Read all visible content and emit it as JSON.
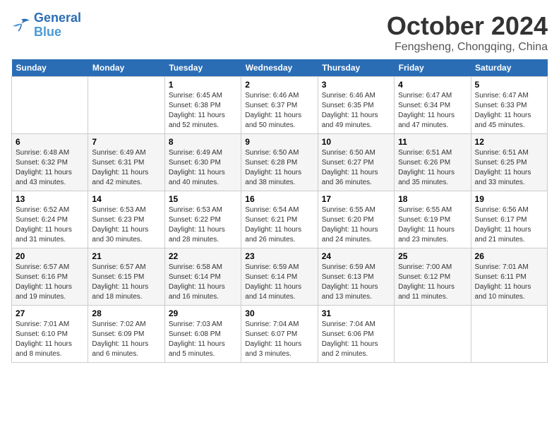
{
  "header": {
    "logo_line1": "General",
    "logo_line2": "Blue",
    "month": "October 2024",
    "location": "Fengsheng, Chongqing, China"
  },
  "weekdays": [
    "Sunday",
    "Monday",
    "Tuesday",
    "Wednesday",
    "Thursday",
    "Friday",
    "Saturday"
  ],
  "weeks": [
    [
      {
        "day": "",
        "info": ""
      },
      {
        "day": "",
        "info": ""
      },
      {
        "day": "1",
        "info": "Sunrise: 6:45 AM\nSunset: 6:38 PM\nDaylight: 11 hours and 52 minutes."
      },
      {
        "day": "2",
        "info": "Sunrise: 6:46 AM\nSunset: 6:37 PM\nDaylight: 11 hours and 50 minutes."
      },
      {
        "day": "3",
        "info": "Sunrise: 6:46 AM\nSunset: 6:35 PM\nDaylight: 11 hours and 49 minutes."
      },
      {
        "day": "4",
        "info": "Sunrise: 6:47 AM\nSunset: 6:34 PM\nDaylight: 11 hours and 47 minutes."
      },
      {
        "day": "5",
        "info": "Sunrise: 6:47 AM\nSunset: 6:33 PM\nDaylight: 11 hours and 45 minutes."
      }
    ],
    [
      {
        "day": "6",
        "info": "Sunrise: 6:48 AM\nSunset: 6:32 PM\nDaylight: 11 hours and 43 minutes."
      },
      {
        "day": "7",
        "info": "Sunrise: 6:49 AM\nSunset: 6:31 PM\nDaylight: 11 hours and 42 minutes."
      },
      {
        "day": "8",
        "info": "Sunrise: 6:49 AM\nSunset: 6:30 PM\nDaylight: 11 hours and 40 minutes."
      },
      {
        "day": "9",
        "info": "Sunrise: 6:50 AM\nSunset: 6:28 PM\nDaylight: 11 hours and 38 minutes."
      },
      {
        "day": "10",
        "info": "Sunrise: 6:50 AM\nSunset: 6:27 PM\nDaylight: 11 hours and 36 minutes."
      },
      {
        "day": "11",
        "info": "Sunrise: 6:51 AM\nSunset: 6:26 PM\nDaylight: 11 hours and 35 minutes."
      },
      {
        "day": "12",
        "info": "Sunrise: 6:51 AM\nSunset: 6:25 PM\nDaylight: 11 hours and 33 minutes."
      }
    ],
    [
      {
        "day": "13",
        "info": "Sunrise: 6:52 AM\nSunset: 6:24 PM\nDaylight: 11 hours and 31 minutes."
      },
      {
        "day": "14",
        "info": "Sunrise: 6:53 AM\nSunset: 6:23 PM\nDaylight: 11 hours and 30 minutes."
      },
      {
        "day": "15",
        "info": "Sunrise: 6:53 AM\nSunset: 6:22 PM\nDaylight: 11 hours and 28 minutes."
      },
      {
        "day": "16",
        "info": "Sunrise: 6:54 AM\nSunset: 6:21 PM\nDaylight: 11 hours and 26 minutes."
      },
      {
        "day": "17",
        "info": "Sunrise: 6:55 AM\nSunset: 6:20 PM\nDaylight: 11 hours and 24 minutes."
      },
      {
        "day": "18",
        "info": "Sunrise: 6:55 AM\nSunset: 6:19 PM\nDaylight: 11 hours and 23 minutes."
      },
      {
        "day": "19",
        "info": "Sunrise: 6:56 AM\nSunset: 6:17 PM\nDaylight: 11 hours and 21 minutes."
      }
    ],
    [
      {
        "day": "20",
        "info": "Sunrise: 6:57 AM\nSunset: 6:16 PM\nDaylight: 11 hours and 19 minutes."
      },
      {
        "day": "21",
        "info": "Sunrise: 6:57 AM\nSunset: 6:15 PM\nDaylight: 11 hours and 18 minutes."
      },
      {
        "day": "22",
        "info": "Sunrise: 6:58 AM\nSunset: 6:14 PM\nDaylight: 11 hours and 16 minutes."
      },
      {
        "day": "23",
        "info": "Sunrise: 6:59 AM\nSunset: 6:14 PM\nDaylight: 11 hours and 14 minutes."
      },
      {
        "day": "24",
        "info": "Sunrise: 6:59 AM\nSunset: 6:13 PM\nDaylight: 11 hours and 13 minutes."
      },
      {
        "day": "25",
        "info": "Sunrise: 7:00 AM\nSunset: 6:12 PM\nDaylight: 11 hours and 11 minutes."
      },
      {
        "day": "26",
        "info": "Sunrise: 7:01 AM\nSunset: 6:11 PM\nDaylight: 11 hours and 10 minutes."
      }
    ],
    [
      {
        "day": "27",
        "info": "Sunrise: 7:01 AM\nSunset: 6:10 PM\nDaylight: 11 hours and 8 minutes."
      },
      {
        "day": "28",
        "info": "Sunrise: 7:02 AM\nSunset: 6:09 PM\nDaylight: 11 hours and 6 minutes."
      },
      {
        "day": "29",
        "info": "Sunrise: 7:03 AM\nSunset: 6:08 PM\nDaylight: 11 hours and 5 minutes."
      },
      {
        "day": "30",
        "info": "Sunrise: 7:04 AM\nSunset: 6:07 PM\nDaylight: 11 hours and 3 minutes."
      },
      {
        "day": "31",
        "info": "Sunrise: 7:04 AM\nSunset: 6:06 PM\nDaylight: 11 hours and 2 minutes."
      },
      {
        "day": "",
        "info": ""
      },
      {
        "day": "",
        "info": ""
      }
    ]
  ]
}
